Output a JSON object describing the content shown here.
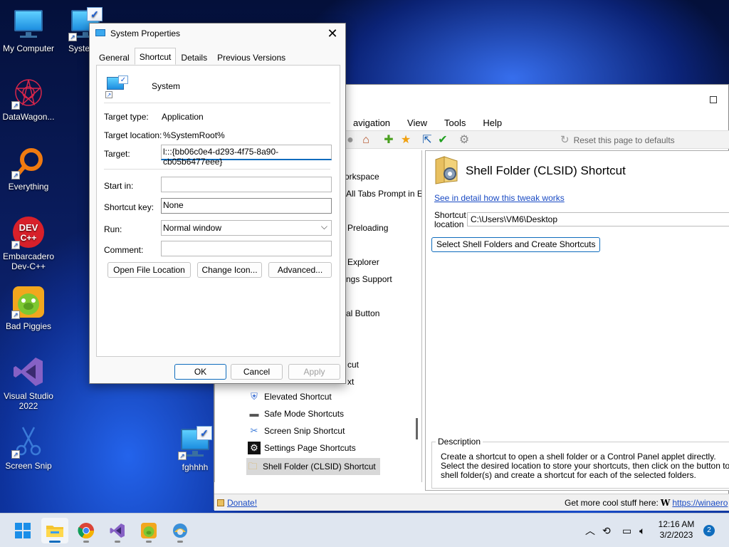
{
  "desktop": {
    "icons": [
      {
        "label": "My Computer"
      },
      {
        "label": "Syste"
      },
      {
        "label": "DataWagon..."
      },
      {
        "label": "Everything"
      },
      {
        "label": "Embarcadero Dev-C++"
      },
      {
        "label": "Bad Piggies"
      },
      {
        "label": "Visual Studio 2022"
      },
      {
        "label": "Screen Snip"
      },
      {
        "label": "fghhhh"
      }
    ]
  },
  "dialog": {
    "title": "System Properties",
    "tabs": [
      "General",
      "Shortcut",
      "Details",
      "Previous Versions"
    ],
    "active_tab": "Shortcut",
    "name": "System",
    "fields": {
      "target_type_label": "Target type:",
      "target_type_value": "Application",
      "target_location_label": "Target location:",
      "target_location_value": "%SystemRoot%",
      "target_label": "Target:",
      "target_value": "l:::{bb06c0e4-d293-4f75-8a90-cb05b6477eee}",
      "start_in_label": "Start in:",
      "start_in_value": "",
      "shortcut_key_label": "Shortcut key:",
      "shortcut_key_value": "None",
      "run_label": "Run:",
      "run_value": "Normal window",
      "comment_label": "Comment:",
      "comment_value": ""
    },
    "buttons": {
      "open_file_location": "Open File Location",
      "change_icon": "Change Icon...",
      "advanced": "Advanced...",
      "ok": "OK",
      "cancel": "Cancel",
      "apply": "Apply"
    }
  },
  "winaero": {
    "menu": [
      "avigation",
      "View",
      "Tools",
      "Help"
    ],
    "reset_label": "Reset this page to defaults",
    "tree": [
      "orkspace",
      "All Tabs Prompt in E",
      "Preloading",
      "Explorer",
      "ngs Support",
      "al Button",
      "cut",
      "xt",
      "Elevated Shortcut",
      "Safe Mode Shortcuts",
      "Screen Snip Shortcut",
      "Settings Page Shortcuts",
      "Shell Folder (CLSID) Shortcut"
    ],
    "panel": {
      "heading": "Shell Folder (CLSID) Shortcut",
      "link": "See in detail how this tweak works",
      "location_label_1": "Shortcut",
      "location_label_2": "location",
      "location_value": "C:\\Users\\VM6\\Desktop",
      "select_button": "Select Shell Folders and Create Shortcuts",
      "description_title": "Description",
      "description_lines": [
        "Create a shortcut to open a shell folder or a Control Panel applet directly.",
        "Select the desired location to store your shortcuts, then click on the button to select th",
        "shell folder(s) and create a shortcut for each of the selected folders."
      ]
    },
    "status": {
      "donate": "Donate!",
      "more": "Get more cool stuff here:",
      "w": "W",
      "url": "https://winaero"
    }
  },
  "taskbar": {
    "time": "12:16 AM",
    "date": "3/2/2023",
    "notifications": "2"
  }
}
